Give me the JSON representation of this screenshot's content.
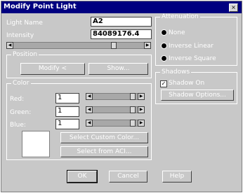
{
  "window": {
    "title": "Modify Point Light",
    "close_glyph": "×"
  },
  "light": {
    "name_label": "Light Name",
    "name_value": "A2",
    "intensity_label": "Intensity",
    "intensity_value": "84089176.4"
  },
  "position": {
    "group_label": "Position",
    "modify_label": "Modify <",
    "show_label": "Show..."
  },
  "attenuation": {
    "group_label": "Attenuation",
    "options": [
      "None",
      "Inverse Linear",
      "Inverse Square"
    ]
  },
  "shadows": {
    "group_label": "Shadows",
    "shadow_on_label": "Shadow On",
    "shadow_on_checked": true,
    "options_label": "Shadow Options..."
  },
  "color": {
    "group_label": "Color",
    "red_label": "Red:",
    "red_value": "1",
    "green_label": "Green:",
    "green_value": "1",
    "blue_label": "Blue:",
    "blue_value": "1",
    "custom_label": "Select Custom Color...",
    "aci_label": "Select from ACI..."
  },
  "buttons": {
    "ok": "OK",
    "cancel": "Cancel",
    "help": "Help"
  }
}
